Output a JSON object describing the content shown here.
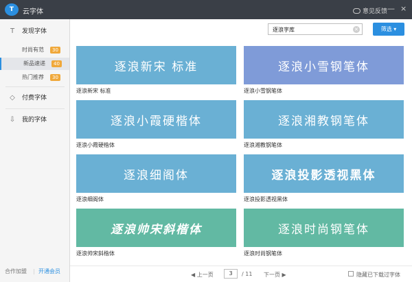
{
  "titlebar": {
    "app_title": "云字体",
    "feedback_label": "意见反馈",
    "min": "—",
    "close": "×"
  },
  "sidebar": {
    "discover": {
      "label": "发现字体",
      "icon": "T"
    },
    "subs": [
      {
        "label": "时尚有范",
        "badge": "30"
      },
      {
        "label": "新品速递",
        "badge": "40"
      },
      {
        "label": "热门推荐",
        "badge": "30"
      }
    ],
    "paid": {
      "label": "付费字体",
      "icon": "◇"
    },
    "mine": {
      "label": "我的字体",
      "icon": "⇩"
    },
    "footer": {
      "coop": "合作加盟",
      "sep": "|",
      "vip": "开通会员"
    }
  },
  "search": {
    "value": "逐浪字库",
    "clear": "×"
  },
  "filter_label": "筛选 ▾",
  "fonts": [
    {
      "preview": "逐浪新宋 标准",
      "name": "逐浪新宋 标准",
      "color": "#6ab0d4"
    },
    {
      "preview": "逐浪小雪钢笔体",
      "name": "逐浪小雪钢笔体",
      "color": "#7f9bd8"
    },
    {
      "preview": "逐浪小霞硬楷体",
      "name": "逐浪小霞硬楷体",
      "color": "#6ab0d4"
    },
    {
      "preview": "逐浪湘教钢笔体",
      "name": "逐浪湘教钢笔体",
      "color": "#6ab0d4"
    },
    {
      "preview": "逐浪细阁体",
      "name": "逐浪细阁体",
      "color": "#6ab0d4"
    },
    {
      "preview": "逐浪投影透视黑体",
      "name": "逐浪投影透视黑体",
      "color": "#6ab0d4"
    },
    {
      "preview": "逐浪帅宋斜楷体",
      "name": "逐浪帅宋斜楷体",
      "color": "#62b9a3"
    },
    {
      "preview": "逐浪时尚钢笔体",
      "name": "逐浪时尚钢笔体",
      "color": "#62b9a3"
    }
  ],
  "pager": {
    "prev": "◀ 上一页",
    "current": "3",
    "total": "/ 11",
    "next": "下一页 ▶",
    "hide_label": "隐藏已下载过字体"
  }
}
